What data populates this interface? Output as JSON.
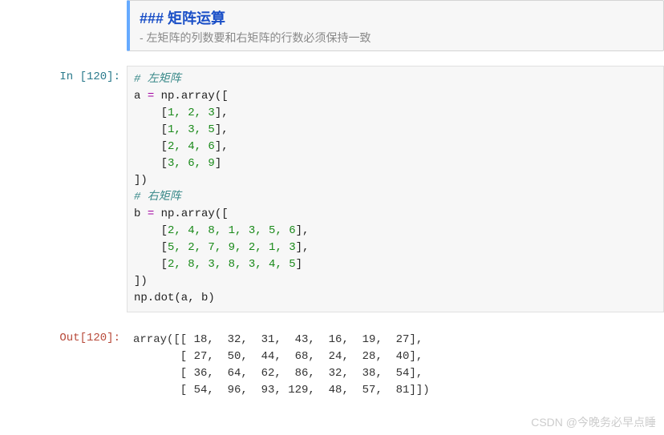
{
  "markdown": {
    "heading": "### 矩阵运算",
    "bullet": "- 左矩阵的列数要和右矩阵的行数必须保持一致"
  },
  "input": {
    "prompt": "In  [120]:",
    "code": {
      "comment1": "# 左矩阵",
      "line2a": "a ",
      "line2op": "= ",
      "line2b": "np.array([",
      "row_a1": "    [",
      "a1": "1, 2, 3",
      "row_close": "],",
      "row_a2": "    [",
      "a2": "1, 3, 5",
      "row_a3": "    [",
      "a3": "2, 4, 6",
      "row_a4": "    [",
      "a4": "3, 6, 9",
      "row_a4_close": "]",
      "close_a": "])",
      "comment2": "# 右矩阵",
      "line_b1": "b ",
      "line_b1b": "np.array([",
      "row_b1": "    [",
      "b1": "2, 4, 8, 1, 3, 5, 6",
      "row_b2": "    [",
      "b2": "5, 2, 7, 9, 2, 1, 3",
      "row_b3": "    [",
      "b3": "2, 8, 3, 8, 3, 4, 5",
      "row_b3_close": "]",
      "close_b": "])",
      "dot": "np.dot(a, b)"
    }
  },
  "output": {
    "prompt": "Out[120]:",
    "text": "array([[ 18,  32,  31,  43,  16,  19,  27],\n       [ 27,  50,  44,  68,  24,  28,  40],\n       [ 36,  64,  62,  86,  32,  38,  54],\n       [ 54,  96,  93, 129,  48,  57,  81]])"
  },
  "watermark": "CSDN @今晚务必早点睡"
}
